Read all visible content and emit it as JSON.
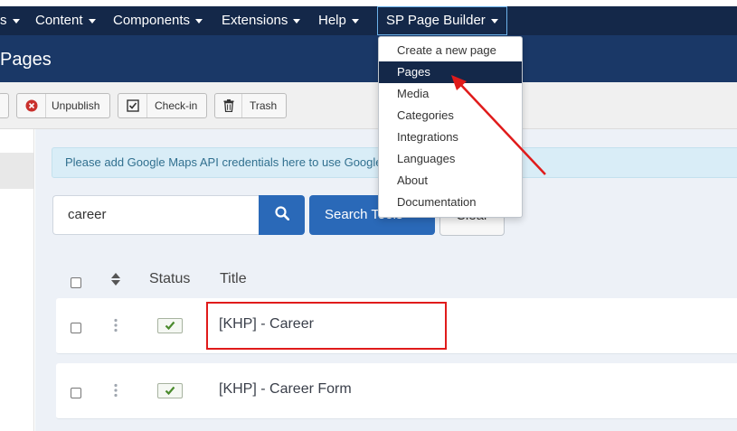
{
  "navbar": {
    "items": [
      {
        "label": "s"
      },
      {
        "label": "Content"
      },
      {
        "label": "Components"
      },
      {
        "label": "Extensions"
      },
      {
        "label": "Help"
      },
      {
        "label": "SP Page Builder"
      }
    ]
  },
  "header": {
    "title": "Pages"
  },
  "toolbar": {
    "unpublish_label": "Unpublish",
    "checkin_label": "Check-in",
    "trash_label": "Trash"
  },
  "alert": {
    "text": "Please add Google Maps API credentials here to use Google"
  },
  "search": {
    "value": "career",
    "tools_label": "Search Tools",
    "clear_label": "Clear"
  },
  "table": {
    "headers": {
      "status": "Status",
      "title": "Title"
    },
    "rows": [
      {
        "title": "[KHP] - Career"
      },
      {
        "title": "[KHP] - Career Form"
      }
    ]
  },
  "dropdown": {
    "items": [
      {
        "label": "Create a new page"
      },
      {
        "label": "Pages"
      },
      {
        "label": "Media"
      },
      {
        "label": "Categories"
      },
      {
        "label": "Integrations"
      },
      {
        "label": "Languages"
      },
      {
        "label": "About"
      },
      {
        "label": "Documentation"
      }
    ],
    "selected": "Pages"
  },
  "icons": {
    "unpublish": "circle-x-icon",
    "checkin": "checkbox-icon",
    "trash": "trash-icon",
    "search": "search-icon",
    "sort": "sort-icon",
    "drag": "drag-handle-icon",
    "status": "checkmark-icon"
  },
  "colors": {
    "navbar": "#142849",
    "header": "#1a3867",
    "primary_button": "#2a69b8",
    "annotation": "#e01b1b",
    "published": "#4a8a2c"
  }
}
